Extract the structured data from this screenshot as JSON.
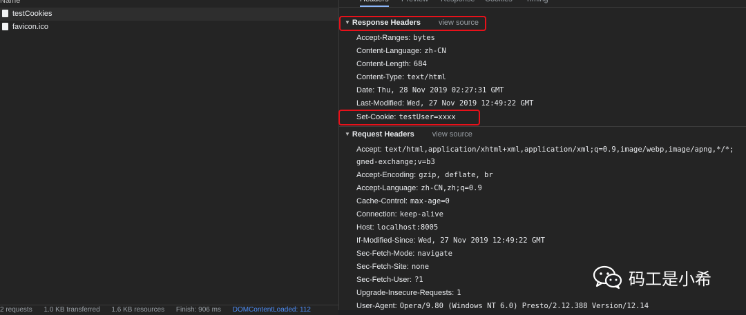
{
  "left": {
    "header": "Name",
    "files": [
      "testCookies",
      "favicon.ico"
    ],
    "status": {
      "requests": "2 requests",
      "transferred": "1.0 KB transferred",
      "resources": "1.6 KB resources",
      "finish": "Finish: 906 ms",
      "dom": "DOMContentLoaded: 112"
    }
  },
  "tabs": [
    "Headers",
    "Preview",
    "Response",
    "Cookies",
    "Timing"
  ],
  "response_headers": {
    "title": "Response Headers",
    "view_source": "view source",
    "items": [
      {
        "k": "Accept-Ranges:",
        "v": "bytes"
      },
      {
        "k": "Content-Language:",
        "v": "zh-CN"
      },
      {
        "k": "Content-Length:",
        "v": "684"
      },
      {
        "k": "Content-Type:",
        "v": "text/html"
      },
      {
        "k": "Date:",
        "v": "Thu, 28 Nov 2019 02:27:31 GMT"
      },
      {
        "k": "Last-Modified:",
        "v": "Wed, 27 Nov 2019 12:49:22 GMT"
      },
      {
        "k": "Set-Cookie:",
        "v": "testUser=xxxx"
      }
    ]
  },
  "request_headers": {
    "title": "Request Headers",
    "view_source": "view source",
    "items": [
      {
        "k": "Accept:",
        "v": "text/html,application/xhtml+xml,application/xml;q=0.9,image/webp,image/apng,*/*;"
      },
      {
        "k": "",
        "v": "gned-exchange;v=b3"
      },
      {
        "k": "Accept-Encoding:",
        "v": "gzip, deflate, br"
      },
      {
        "k": "Accept-Language:",
        "v": "zh-CN,zh;q=0.9"
      },
      {
        "k": "Cache-Control:",
        "v": "max-age=0"
      },
      {
        "k": "Connection:",
        "v": "keep-alive"
      },
      {
        "k": "Host:",
        "v": "localhost:8005"
      },
      {
        "k": "If-Modified-Since:",
        "v": "Wed, 27 Nov 2019 12:49:22 GMT"
      },
      {
        "k": "Sec-Fetch-Mode:",
        "v": "navigate"
      },
      {
        "k": "Sec-Fetch-Site:",
        "v": "none"
      },
      {
        "k": "Sec-Fetch-User:",
        "v": "?1"
      },
      {
        "k": "Upgrade-Insecure-Requests:",
        "v": "1"
      },
      {
        "k": "User-Agent:",
        "v": "Opera/9.80 (Windows NT 6.0) Presto/2.12.388 Version/12.14"
      }
    ]
  },
  "watermark": {
    "text": "码工是小希",
    "icon": "wechat-icon"
  },
  "colors": {
    "highlight": "#e8111a",
    "link": "#4d8df6"
  }
}
